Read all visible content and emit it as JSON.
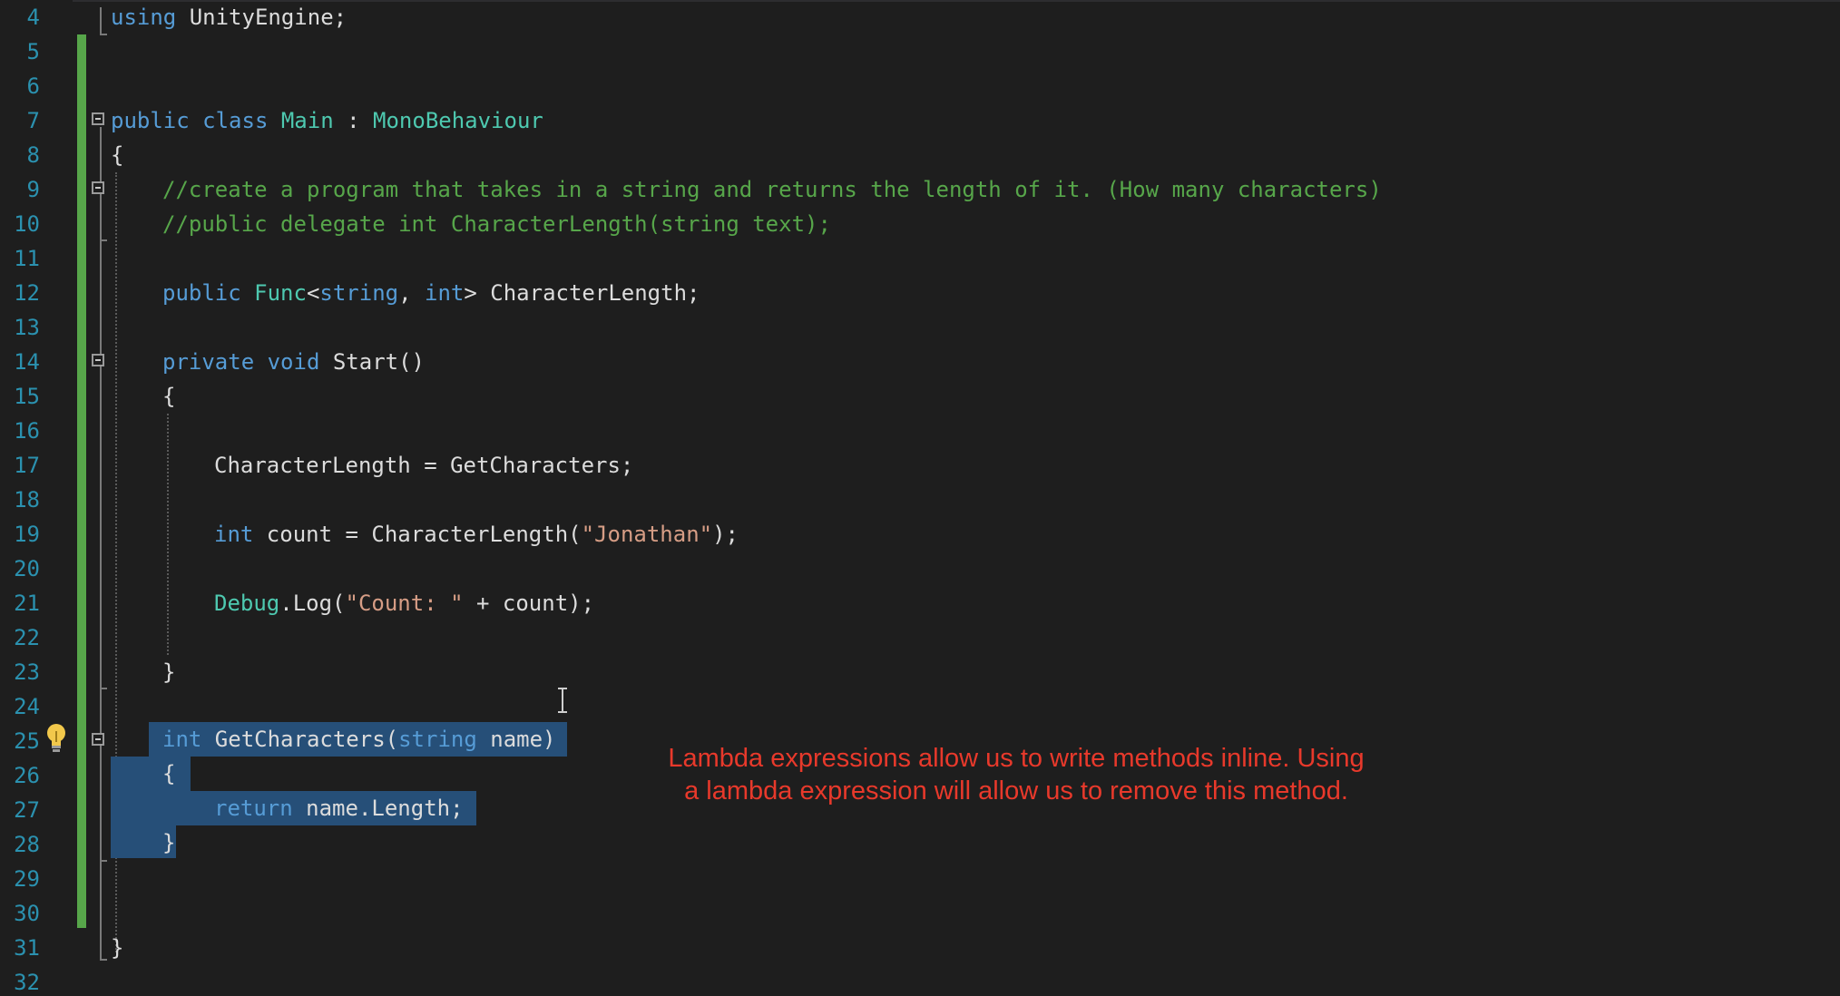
{
  "editor": {
    "line_numbers": [
      "4",
      "5",
      "6",
      "7",
      "8",
      "9",
      "10",
      "11",
      "12",
      "13",
      "14",
      "15",
      "16",
      "17",
      "18",
      "19",
      "20",
      "21",
      "22",
      "23",
      "24",
      "25",
      "26",
      "27",
      "28",
      "29",
      "30",
      "31",
      "32"
    ],
    "lines": {
      "l4": {
        "a": "using",
        "b": " UnityEngine;"
      },
      "l7": {
        "a": "public",
        "b": " ",
        "c": "class",
        "d": " ",
        "e": "Main",
        "f": " : ",
        "g": "MonoBehaviour"
      },
      "l8": {
        "a": "{"
      },
      "l9": {
        "a": "//create a program that takes in a string and returns the length of it. (How many characters)"
      },
      "l10": {
        "a": "//public delegate int CharacterLength(string text);"
      },
      "l12": {
        "a": "public",
        "b": " ",
        "c": "Func",
        "d": "<",
        "e": "string",
        "f": ", ",
        "g": "int",
        "h": "> CharacterLength;"
      },
      "l14": {
        "a": "private",
        "b": " ",
        "c": "void",
        "d": " Start()"
      },
      "l15": {
        "a": "{"
      },
      "l17": {
        "a": "CharacterLength = GetCharacters;"
      },
      "l19": {
        "a": "int",
        "b": " count = CharacterLength(",
        "c": "\"Jonathan\"",
        "d": ");"
      },
      "l21": {
        "a": "Debug",
        "b": ".Log(",
        "c": "\"Count: \"",
        "d": " + count);"
      },
      "l23": {
        "a": "}"
      },
      "l25": {
        "a": "int",
        "b": " GetCharacters(",
        "c": "string",
        "d": " name)"
      },
      "l26": {
        "a": "{"
      },
      "l27": {
        "a": "return",
        "b": " name.Length;"
      },
      "l28": {
        "a": "}"
      },
      "l31": {
        "a": "}"
      }
    },
    "colors": {
      "background": "#1e1e1e",
      "keyword": "#569cd6",
      "type": "#4ec9b0",
      "comment": "#57a64a",
      "string": "#d69d85",
      "text": "#dcdcdc",
      "line_number": "#2b91af",
      "selection": "#264f78",
      "change_bar": "#57a64a"
    },
    "icons": [
      "lightbulb-icon",
      "text-cursor-icon",
      "collapse-icon"
    ]
  },
  "annotation": {
    "line1": "Lambda expressions allow us to write methods inline. Using",
    "line2": "a lambda expression will allow us to remove this method.",
    "color": "#e8392b"
  }
}
